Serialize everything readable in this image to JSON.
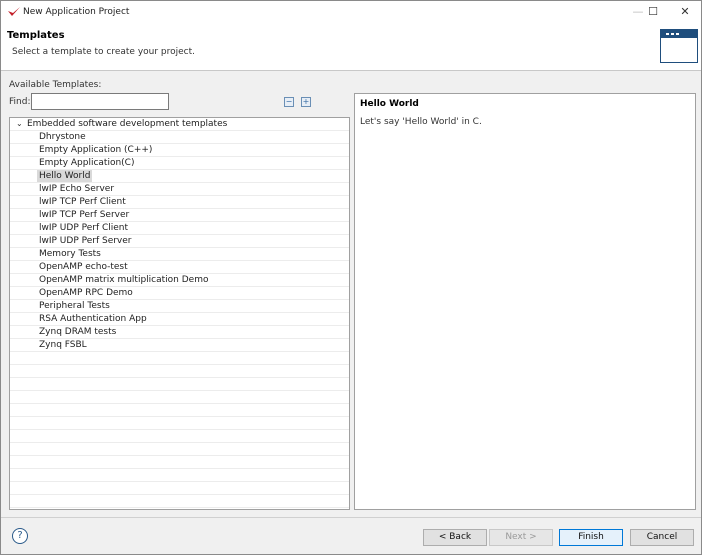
{
  "window": {
    "title": "New Application Project",
    "minimize": "—",
    "maximize": "☐",
    "close": "✕"
  },
  "header": {
    "title": "Templates",
    "subtitle": "Select a template to create your project."
  },
  "available_label": "Available Templates:",
  "find": {
    "label": "Find:",
    "value": ""
  },
  "tree": {
    "parent": "Embedded software development templates",
    "items": [
      "Dhrystone",
      "Empty Application (C++)",
      "Empty Application(C)",
      "Hello World",
      "lwIP Echo Server",
      "lwIP TCP Perf Client",
      "lwIP TCP Perf Server",
      "lwIP UDP Perf Client",
      "lwIP UDP Perf Server",
      "Memory Tests",
      "OpenAMP echo-test",
      "OpenAMP matrix multiplication Demo",
      "OpenAMP RPC Demo",
      "Peripheral Tests",
      "RSA Authentication App",
      "Zynq DRAM tests",
      "Zynq FSBL"
    ],
    "selected": "Hello World"
  },
  "description": {
    "title": "Hello World",
    "text": "Let's say 'Hello World' in C."
  },
  "buttons": {
    "help": "?",
    "back": "< Back",
    "next": "Next >",
    "finish": "Finish",
    "cancel": "Cancel"
  }
}
